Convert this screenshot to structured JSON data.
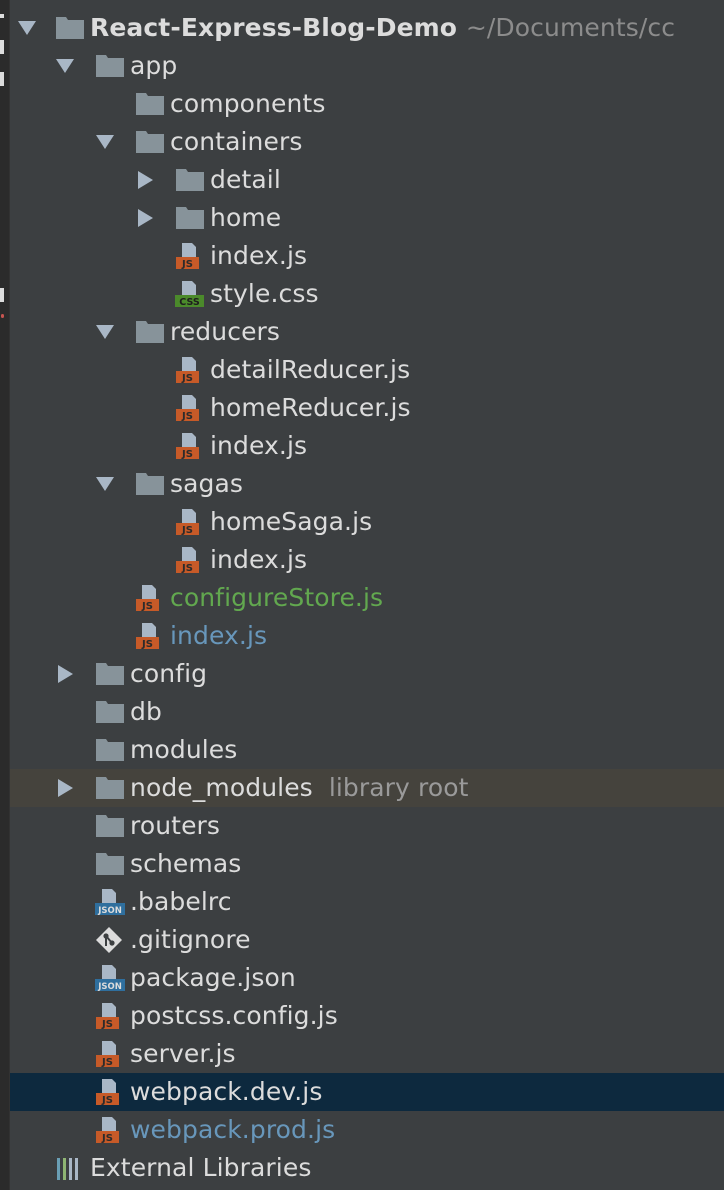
{
  "colors": {
    "background": "#3c3f41",
    "text": "#dcdcdc",
    "modified_file": "#62a84f",
    "changed_file": "#6897bb",
    "excluded": "#808080",
    "library_row": "#45433d",
    "selected_row": "#0d293e",
    "js_badge": "#c65a28",
    "css_badge": "#4b8a2b",
    "json_badge": "#2f6f9e"
  },
  "project": {
    "name": "React-Express-Blog-Demo",
    "path": "~/Documents/cc"
  },
  "tree": [
    {
      "label": "app",
      "kind": "folder"
    },
    {
      "label": "components",
      "kind": "folder"
    },
    {
      "label": "containers",
      "kind": "folder"
    },
    {
      "label": "detail",
      "kind": "folder"
    },
    {
      "label": "home",
      "kind": "folder"
    },
    {
      "label": "index.js",
      "kind": "js"
    },
    {
      "label": "style.css",
      "kind": "css"
    },
    {
      "label": "reducers",
      "kind": "folder"
    },
    {
      "label": "detailReducer.js",
      "kind": "js"
    },
    {
      "label": "homeReducer.js",
      "kind": "js"
    },
    {
      "label": "index.js",
      "kind": "js"
    },
    {
      "label": "sagas",
      "kind": "folder"
    },
    {
      "label": "homeSaga.js",
      "kind": "js"
    },
    {
      "label": "index.js",
      "kind": "js"
    },
    {
      "label": "configureStore.js",
      "kind": "js"
    },
    {
      "label": "index.js",
      "kind": "js"
    },
    {
      "label": "config",
      "kind": "folder"
    },
    {
      "label": "db",
      "kind": "folder"
    },
    {
      "label": "modules",
      "kind": "folder"
    },
    {
      "label": "node_modules",
      "kind": "folder",
      "suffix": "library root"
    },
    {
      "label": "routers",
      "kind": "folder"
    },
    {
      "label": "schemas",
      "kind": "folder"
    },
    {
      "label": ".babelrc",
      "kind": "json"
    },
    {
      "label": ".gitignore",
      "kind": "git"
    },
    {
      "label": "package.json",
      "kind": "json"
    },
    {
      "label": "postcss.config.js",
      "kind": "js"
    },
    {
      "label": "server.js",
      "kind": "js"
    },
    {
      "label": "webpack.dev.js",
      "kind": "js"
    },
    {
      "label": "webpack.prod.js",
      "kind": "js"
    }
  ],
  "external_libraries": "External Libraries",
  "badges": {
    "js": "JS",
    "css": "CSS",
    "json": "JSON"
  }
}
